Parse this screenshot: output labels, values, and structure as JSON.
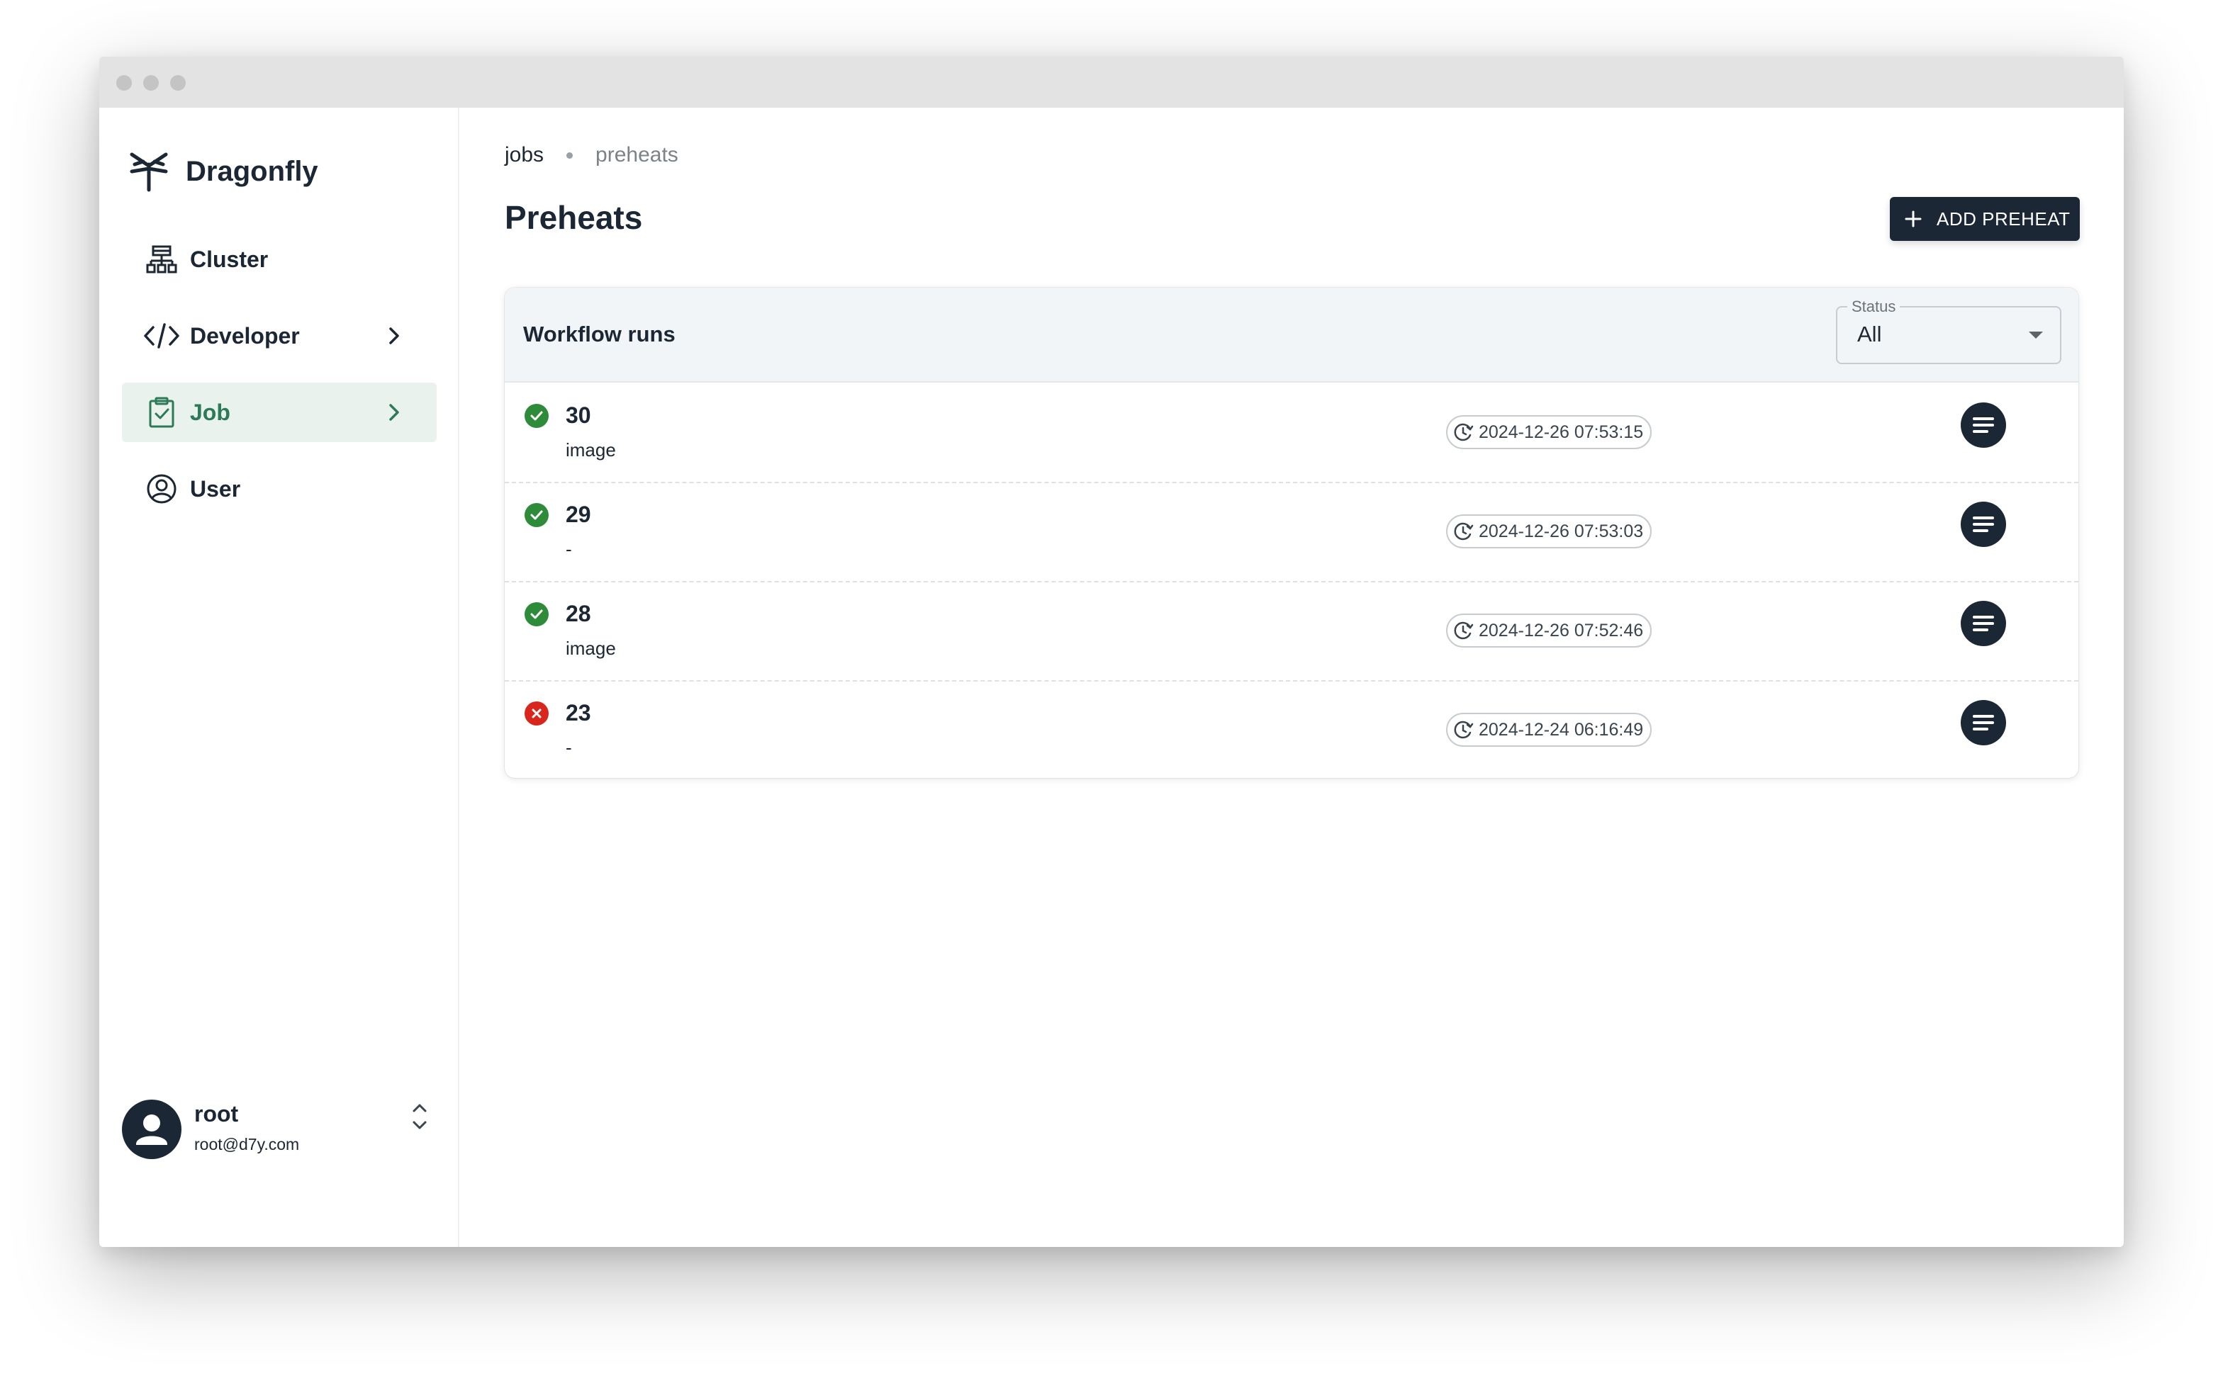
{
  "app": {
    "name": "Dragonfly",
    "logo_icon": "dragonfly-logo-icon"
  },
  "sidebar": {
    "items": [
      {
        "label": "Cluster",
        "icon": "cluster-icon",
        "has_chevron": false,
        "active": false
      },
      {
        "label": "Developer",
        "icon": "code-icon",
        "has_chevron": true,
        "active": false
      },
      {
        "label": "Job",
        "icon": "clipboard-check-icon",
        "has_chevron": true,
        "active": true
      },
      {
        "label": "User",
        "icon": "user-circle-icon",
        "has_chevron": false,
        "active": false
      }
    ],
    "user": {
      "name": "root",
      "email": "root@d7y.com",
      "avatar_icon": "person-icon",
      "toggle_icon": "unfold-icon"
    }
  },
  "breadcrumb": {
    "parent": "jobs",
    "current": "preheats"
  },
  "page": {
    "title": "Preheats",
    "add_button_label": "ADD PREHEAT"
  },
  "workflow": {
    "title": "Workflow runs",
    "status_filter": {
      "label": "Status",
      "value": "All"
    },
    "runs": [
      {
        "id": "30",
        "type": "image",
        "status": "success",
        "time": "2024-12-26 07:53:15"
      },
      {
        "id": "29",
        "type": "-",
        "status": "success",
        "time": "2024-12-26 07:53:03"
      },
      {
        "id": "28",
        "type": "image",
        "status": "success",
        "time": "2024-12-26 07:52:46"
      },
      {
        "id": "23",
        "type": "-",
        "status": "failure",
        "time": "2024-12-24 06:16:49"
      }
    ]
  },
  "colors": {
    "primary_dark": "#1c2735",
    "active_green": "#2c7a57",
    "active_bg": "#eaf2ee",
    "success": "#2e8b3a",
    "failure": "#d8261d"
  }
}
